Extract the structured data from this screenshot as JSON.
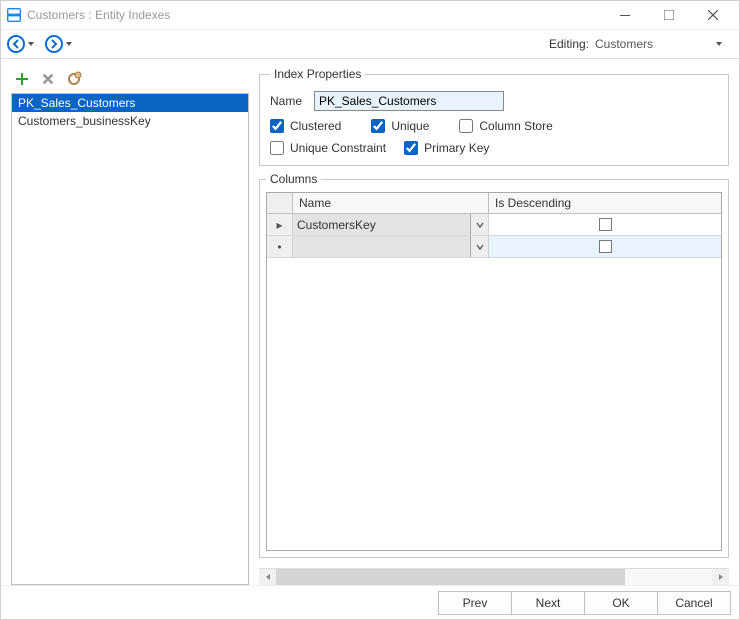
{
  "window": {
    "title": "Customers : Entity Indexes"
  },
  "nav": {
    "editing_label": "Editing:",
    "editing_value": "Customers"
  },
  "sidebar": {
    "items": [
      {
        "label": "PK_Sales_Customers",
        "selected": true
      },
      {
        "label": "Customers_businessKey",
        "selected": false
      }
    ]
  },
  "index_properties": {
    "legend": "Index Properties",
    "name_label": "Name",
    "name_value": "PK_Sales_Customers",
    "options": {
      "clustered": {
        "label": "Clustered",
        "checked": true
      },
      "unique": {
        "label": "Unique",
        "checked": true
      },
      "column_store": {
        "label": "Column Store",
        "checked": false
      },
      "unique_constraint": {
        "label": "Unique Constraint",
        "checked": false
      },
      "primary_key": {
        "label": "Primary Key",
        "checked": true
      }
    }
  },
  "columns_group": {
    "legend": "Columns",
    "headers": {
      "name": "Name",
      "is_descending": "Is Descending"
    },
    "rows": [
      {
        "marker": "▸",
        "name": "CustomersKey",
        "is_descending": false
      },
      {
        "marker": "•",
        "name": "",
        "is_descending": false,
        "new": true
      }
    ]
  },
  "footer": {
    "prev": "Prev",
    "next": "Next",
    "ok": "OK",
    "cancel": "Cancel"
  }
}
